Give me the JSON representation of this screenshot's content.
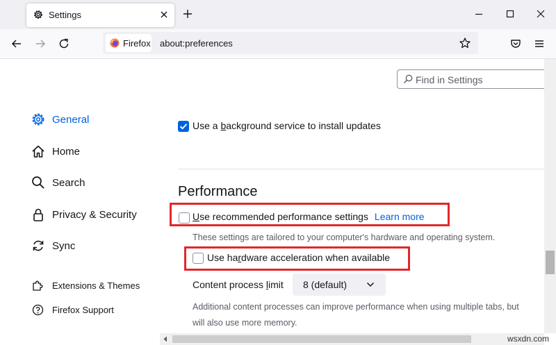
{
  "tab": {
    "title": "Settings"
  },
  "urlbar": {
    "identity": "Firefox",
    "url": "about:preferences"
  },
  "search": {
    "placeholder": "Find in Settings"
  },
  "sidebar": {
    "items": [
      {
        "label": "General",
        "icon": "gear-icon",
        "selected": true
      },
      {
        "label": "Home",
        "icon": "home-icon"
      },
      {
        "label": "Search",
        "icon": "search-icon"
      },
      {
        "label": "Privacy & Security",
        "icon": "lock-icon"
      },
      {
        "label": "Sync",
        "icon": "sync-icon"
      }
    ],
    "footer": [
      {
        "label": "Extensions & Themes",
        "icon": "puzzle-icon"
      },
      {
        "label": "Firefox Support",
        "icon": "help-icon"
      }
    ]
  },
  "main": {
    "background_updates": {
      "label_pre": "Use a ",
      "label_access": "b",
      "label_post": "ackground service to install updates",
      "checked": true
    },
    "performance": {
      "title": "Performance",
      "recommended": {
        "label_access": "U",
        "label_post": "se recommended performance settings",
        "learn_more": "Learn more",
        "checked": false
      },
      "recommended_hint": "These settings are tailored to your computer's hardware and operating system.",
      "hw_accel": {
        "label_pre": "Use ha",
        "label_access": "r",
        "label_post": "dware acceleration when available",
        "checked": false
      },
      "content_process": {
        "label_pre": "Content process ",
        "label_access": "l",
        "label_post": "imit",
        "value": "8 (default)"
      },
      "content_hint_1": "Additional content processes can improve performance when using multiple tabs, but",
      "content_hint_2": "will also use more memory."
    }
  },
  "watermark": "wsxdn.com",
  "colors": {
    "accent": "#0061e0",
    "highlight": "#e3262b"
  }
}
